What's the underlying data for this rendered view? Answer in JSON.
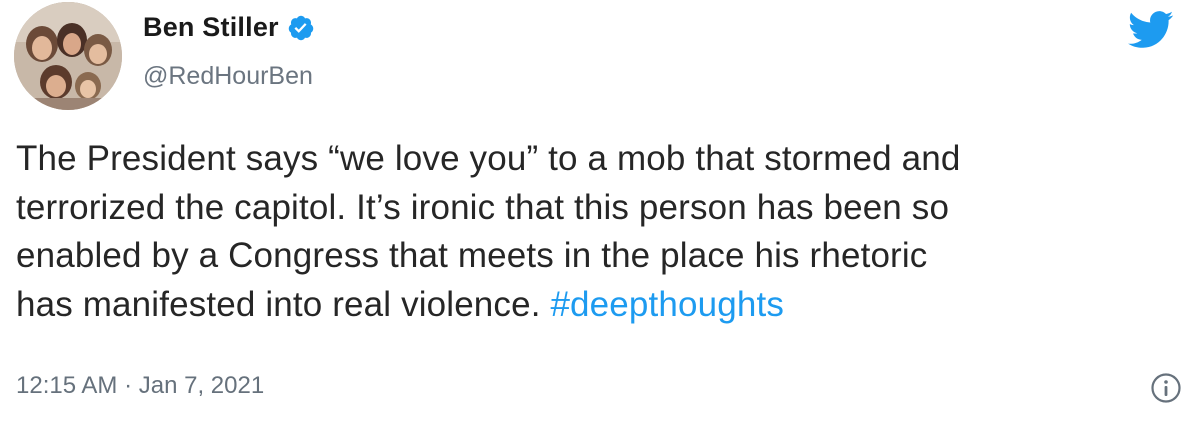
{
  "author": {
    "display_name": "Ben Stiller",
    "handle": "@RedHourBen",
    "verified": true
  },
  "tweet": {
    "lines": [
      "The President says “we love you” to a mob that stormed and",
      "terrorized the capitol. It’s ironic that this person has been so",
      "enabled by a Congress that meets in the place his rhetoric",
      "has manifested into real violence. "
    ],
    "hashtag": "#deepthoughts",
    "timestamp": "12:15 AM · Jan 7, 2021"
  },
  "icons": {
    "brand": "twitter-bird-icon",
    "verified": "verified-badge-icon",
    "info": "info-icon"
  },
  "colors": {
    "accent": "#1d9bf0",
    "text": "#262626",
    "muted": "#66717c"
  }
}
